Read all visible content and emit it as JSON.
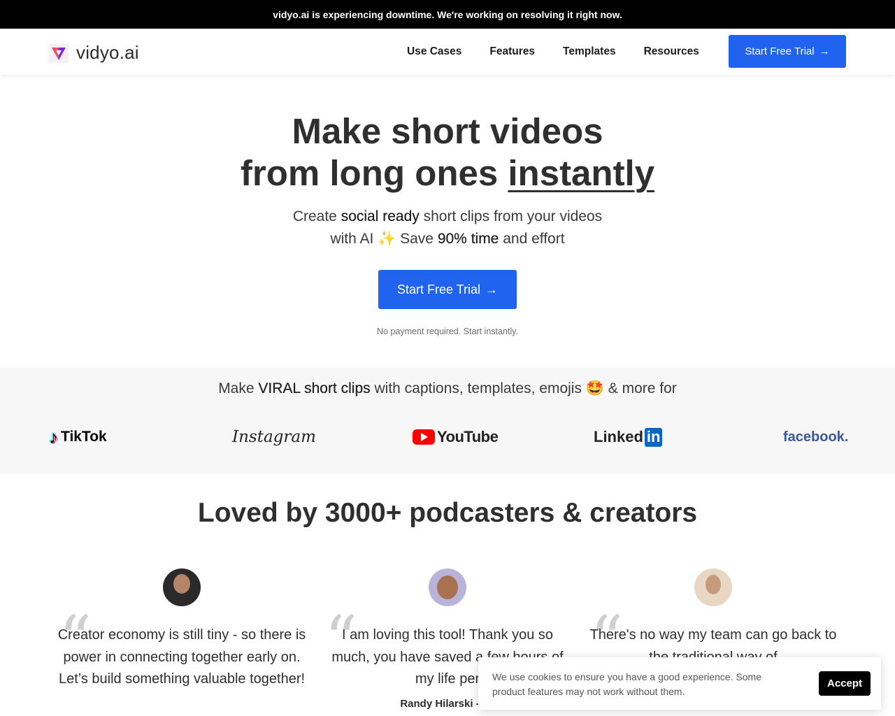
{
  "banner": {
    "text": "vidyo.ai is experiencing downtime. We're working on resolving it right now."
  },
  "header": {
    "logo_text": "vidyo.ai",
    "nav": [
      "Use Cases",
      "Features",
      "Templates",
      "Resources"
    ],
    "cta_label": "Start Free Trial",
    "cta_arrow": "→",
    "brand_color": "#1f63ef"
  },
  "hero": {
    "title_line1": "Make short videos",
    "title_line2_pre": "from long ones ",
    "title_line2_emph": "instantly",
    "sub_pre": "Create ",
    "sub_bold1": "social ready",
    "sub_mid": " short clips from your videos",
    "sub_line2_pre": "with AI ✨ Save ",
    "sub_bold2": "90% time",
    "sub_line2_post": " and effort",
    "cta_label": "Start Free Trial",
    "cta_arrow": "→",
    "note": "No payment required. Start instantly."
  },
  "platforms": {
    "title_pre": "Make ",
    "title_bold": "VIRAL short clips",
    "title_post": " with captions, templates, emojis 🤩 & more for",
    "logos": {
      "tiktok": "TikTok",
      "tiktok_icon": "♪",
      "instagram": "Instagram",
      "youtube": "YouTube",
      "linkedin_a": "Linked",
      "linkedin_b": "in",
      "facebook": "facebook."
    }
  },
  "testimonials": {
    "heading": "Loved by 3000+ podcasters & creators",
    "quote_glyph": "“",
    "items": [
      {
        "quote": "Creator economy is still tiny - so there is power in connecting together early on. Let’s build something valuable together!",
        "author": ""
      },
      {
        "quote": "I am loving this tool! Thank you so much, you have saved a few hours of my life per",
        "author": "Randy Hilarski - Yo"
      },
      {
        "quote": "There's no way my team can go back to the traditional way of",
        "author": ""
      }
    ]
  },
  "cookie": {
    "text": "We use cookies to ensure you have a good experience. Some product features may not work without them.",
    "accept_label": "Accept"
  }
}
